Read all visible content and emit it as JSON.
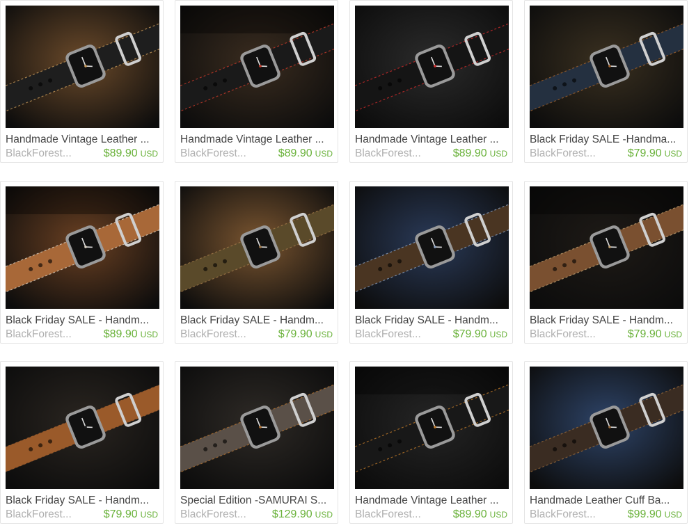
{
  "listings": [
    {
      "title": "Handmade Vintage Leather ...",
      "shop": "BlackForest...",
      "price": "$89.90",
      "currency": "USD",
      "image": {
        "bg": "#6b4a2a",
        "strap": "#1e1e1e",
        "accent": "#c89a5a"
      }
    },
    {
      "title": "Handmade Vintage Leather ...",
      "shop": "BlackForest...",
      "price": "$89.90",
      "currency": "USD",
      "image": {
        "bg": "#3a2c1f",
        "strap": "#1a1a1a",
        "accent": "#c83a2a"
      }
    },
    {
      "title": "Handmade Vintage Leather ...",
      "shop": "BlackForest...",
      "price": "$89.90",
      "currency": "USD",
      "image": {
        "bg": "#2b2b2b",
        "strap": "#151515",
        "accent": "#d02a2a"
      }
    },
    {
      "title": "Black Friday SALE -Handma...",
      "shop": "BlackForest...",
      "price": "$79.90",
      "currency": "USD",
      "image": {
        "bg": "#3a3020",
        "strap": "#243040",
        "accent": "#a0622c"
      }
    },
    {
      "title": "Black Friday SALE - Handm...",
      "shop": "BlackForest...",
      "price": "$89.90",
      "currency": "USD",
      "image": {
        "bg": "#6a4022",
        "strap": "#a86838",
        "accent": "#d9d0c0"
      }
    },
    {
      "title": "Black Friday SALE - Handm...",
      "shop": "BlackForest...",
      "price": "$79.90",
      "currency": "USD",
      "image": {
        "bg": "#7a5530",
        "strap": "#5a4a2a",
        "accent": "#a07848"
      }
    },
    {
      "title": "Black Friday SALE - Handm...",
      "shop": "BlackForest...",
      "price": "$79.90",
      "currency": "USD",
      "image": {
        "bg": "#2a3a58",
        "strap": "#4a3522",
        "accent": "#8aa0c0"
      }
    },
    {
      "title": "Black Friday SALE - Handm...",
      "shop": "BlackForest...",
      "price": "$79.90",
      "currency": "USD",
      "image": {
        "bg": "#1e1a16",
        "strap": "#7a5030",
        "accent": "#c0a070"
      }
    },
    {
      "title": "Black Friday SALE - Handm...",
      "shop": "BlackForest...",
      "price": "$79.90",
      "currency": "USD",
      "image": {
        "bg": "#2a2520",
        "strap": "#9a5a2a",
        "accent": "#1a1a1a"
      }
    },
    {
      "title": "Special Edition -SAMURAI S...",
      "shop": "BlackForest...",
      "price": "$129.90",
      "currency": "USD",
      "image": {
        "bg": "#2e2a26",
        "strap": "#5a5048",
        "accent": "#b07030"
      }
    },
    {
      "title": "Handmade Vintage Leather ...",
      "shop": "BlackForest...",
      "price": "$89.90",
      "currency": "USD",
      "image": {
        "bg": "#252525",
        "strap": "#181818",
        "accent": "#c07a2a"
      }
    },
    {
      "title": "Handmade Leather Cuff Ba...",
      "shop": "BlackForest...",
      "price": "$99.90",
      "currency": "USD",
      "image": {
        "bg": "#2e4468",
        "strap": "#3a2c22",
        "accent": "#9a6a3a"
      }
    }
  ]
}
